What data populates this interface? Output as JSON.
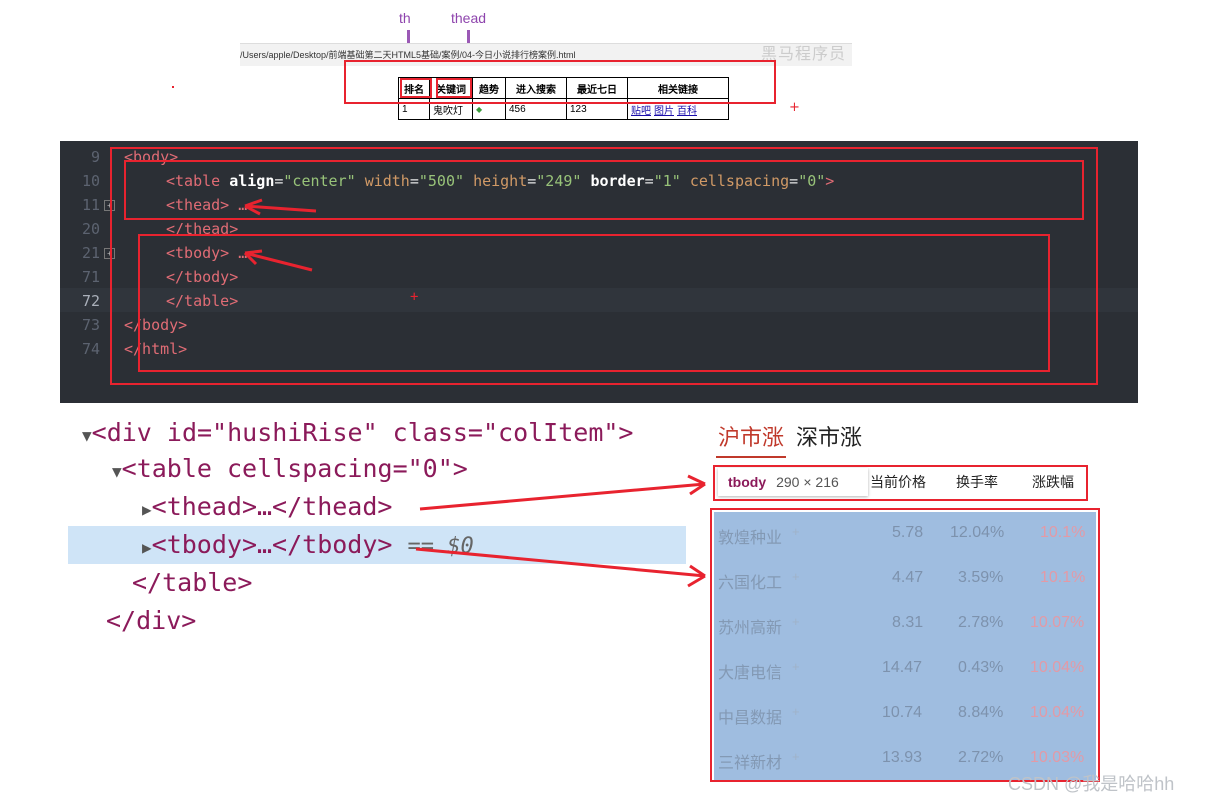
{
  "annotations": {
    "th": "th",
    "thead": "thead"
  },
  "browser": {
    "path": "/Users/apple/Desktop/前端基础第二天HTML5基础/案例/04-今日小说排行榜案例.html",
    "watermark": "黑马程序员",
    "headers": [
      "排名",
      "关键词",
      "趋势",
      "进入搜索",
      "最近七日",
      "相关链接"
    ],
    "row": {
      "rank": "1",
      "keyword": "鬼吹灯",
      "trend": "◆",
      "search": "456",
      "recent": "123",
      "links": [
        "贴吧",
        "图片",
        "百科"
      ]
    }
  },
  "editor": {
    "lines": [
      {
        "no": "9",
        "code": "<body>"
      },
      {
        "no": "10",
        "code": "<table align=\"center\" width=\"500\" height=\"249\" border=\"1\" cellspacing=\"0\">"
      },
      {
        "no": "11",
        "code": "<thead> …"
      },
      {
        "no": "20",
        "code": "</thead>"
      },
      {
        "no": "21",
        "code": "<tbody> …"
      },
      {
        "no": "71",
        "code": "</tbody>"
      },
      {
        "no": "72",
        "code": "</table>"
      },
      {
        "no": "73",
        "code": "</body>"
      },
      {
        "no": "74",
        "code": "</html>"
      }
    ]
  },
  "dom": {
    "div_open": "<div id=\"hushiRise\" class=\"colItem\">",
    "table_open": "<table cellspacing=\"0\">",
    "thead": "<thead>…</thead>",
    "tbody": "<tbody>…</tbody>",
    "selected_marker": "== $0",
    "table_close": "</table>",
    "div_close": "</div>"
  },
  "stock": {
    "tabs": [
      "沪市涨",
      "深市涨"
    ],
    "tooltip": {
      "tag": "tbody",
      "size": "290 × 216"
    },
    "headers": [
      "当前价格",
      "换手率",
      "涨跌幅"
    ],
    "rows": [
      {
        "name": "敦煌种业",
        "price": "5.78",
        "turnover": "12.04%",
        "change": "10.1%"
      },
      {
        "name": "六国化工",
        "price": "4.47",
        "turnover": "3.59%",
        "change": "10.1%"
      },
      {
        "name": "苏州高新",
        "price": "8.31",
        "turnover": "2.78%",
        "change": "10.07%"
      },
      {
        "name": "大唐电信",
        "price": "14.47",
        "turnover": "0.43%",
        "change": "10.04%"
      },
      {
        "name": "中昌数据",
        "price": "10.74",
        "turnover": "8.84%",
        "change": "10.04%"
      },
      {
        "name": "三祥新材",
        "price": "13.93",
        "turnover": "2.72%",
        "change": "10.03%"
      }
    ]
  },
  "watermark": "CSDN @我是哈哈hh",
  "colors": {
    "annotation_red": "#e8232f",
    "annotation_purple": "#9b59b6",
    "editor_bg": "#2b2f35",
    "selection": "#cfe4f7",
    "tbody_highlight": "#9fbde0"
  }
}
